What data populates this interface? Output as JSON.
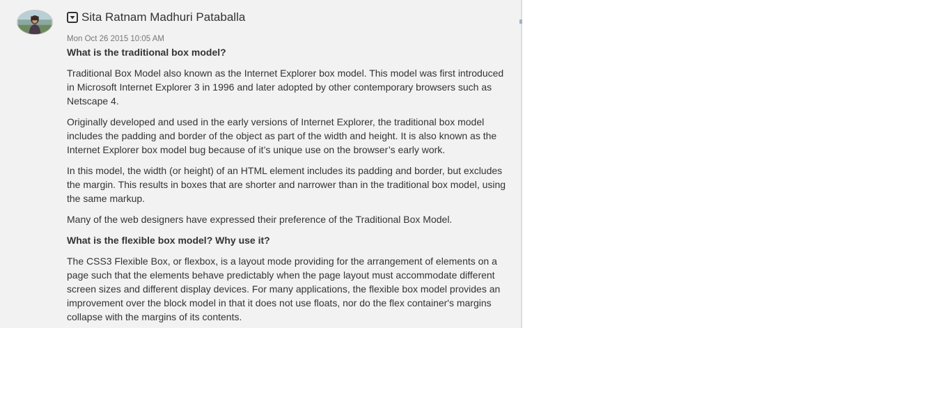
{
  "post": {
    "author": "Sita Ratnam Madhuri Pataballa",
    "date": "Mon Oct 26 2015 10:05 AM",
    "icons": {
      "avatar": "user-avatar-photo",
      "collapse": "collapse-toggle-icon"
    },
    "paragraphs": [
      {
        "type": "heading",
        "text": "What is the traditional box model?"
      },
      {
        "type": "text",
        "text": "Traditional Box Model also known as the Internet Explorer box model. This model was first introduced in Microsoft Internet Explorer 3 in 1996 and later adopted by other contemporary browsers such as Netscape 4."
      },
      {
        "type": "text",
        "text": "Originally developed and used in the early versions of Internet Explorer, the traditional box model includes the padding and border of the object as part of the width and height. It is also known as the Internet Explorer box model bug because of it’s unique use on the browser’s early work."
      },
      {
        "type": "text",
        "text": "In this model, the width (or height) of an HTML element includes its padding and border, but excludes the margin. This results in boxes that are shorter and narrower than in the traditional box model, using the same markup."
      },
      {
        "type": "text",
        "text": "Many of the web designers have expressed their preference of the Traditional Box Model."
      },
      {
        "type": "heading",
        "text": "What is the flexible box model? Why use it?"
      },
      {
        "type": "text",
        "text": "The CSS3 Flexible Box, or flexbox, is a layout mode providing for the arrangement of elements on a page such that the elements behave predictably when the page layout must accommodate different screen sizes and different display devices. For many applications, the flexible box model provides an improvement over the block model in that it does not use floats, nor do the flex container's margins collapse with the margins of its contents."
      }
    ]
  },
  "colors": {
    "panel_bg": "#f2f2f2",
    "text": "#333333",
    "date_text": "#777777",
    "panel_border": "#d6dde6"
  }
}
